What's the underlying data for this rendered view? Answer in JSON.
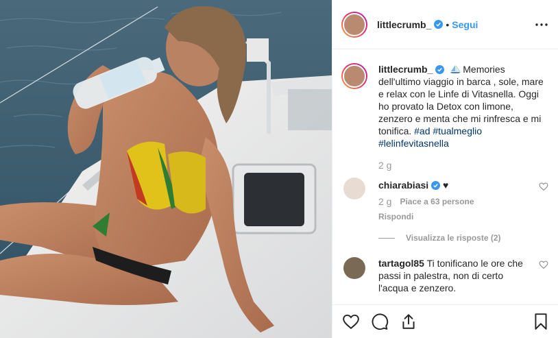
{
  "post": {
    "username": "littlecrumb_",
    "dot": "•",
    "follow_label": "Segui"
  },
  "caption": {
    "username": "littlecrumb_",
    "text": "Memories dell'ultimo viaggio in barca , sole, mare e relax con le Linfe di Vitasnella. Oggi ho provato la Detox con limone, zenzero e menta che mi rinfresca e mi tonifica.",
    "hashtags": [
      "#ad",
      "#tualmeglio",
      "#lelinfevitasnella"
    ],
    "time": "2 g"
  },
  "comments": [
    {
      "username": "chiarabiasi",
      "text": "♥",
      "time": "2 g",
      "likes": "Piace a 63 persone",
      "reply": "Rispondi",
      "view_replies": "Visualizza le risposte (2)"
    },
    {
      "username": "tartagol85",
      "text": "Ti tonificano le ore che passi in palestra, non di certo l'acqua e zenzero."
    }
  ],
  "icons": {
    "more": "more-horizontal-icon",
    "verified": "verified-badge-icon",
    "like": "heart-icon",
    "comment": "comment-icon",
    "share": "share-icon",
    "save": "bookmark-icon"
  },
  "colors": {
    "link": "#3897f0",
    "hashtag": "#003569",
    "meta": "#999999",
    "verified": "#3897f0"
  }
}
